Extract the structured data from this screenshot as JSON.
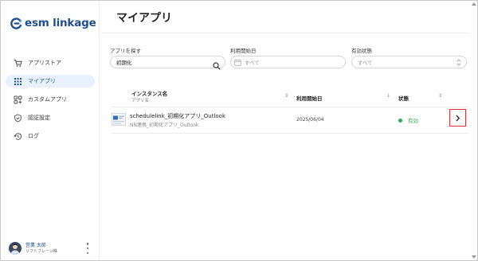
{
  "brand": {
    "logo_text": "esm linkage",
    "color": "#1f4e8c"
  },
  "sidebar": {
    "items": [
      {
        "label": "アプリストア",
        "icon": "store-icon",
        "active": false
      },
      {
        "label": "マイアプリ",
        "icon": "grid-icon",
        "active": true
      },
      {
        "label": "カスタムアプリ",
        "icon": "custom-app-icon",
        "active": false
      },
      {
        "label": "認証設定",
        "icon": "shield-icon",
        "active": false
      },
      {
        "label": "ログ",
        "icon": "history-icon",
        "active": false
      }
    ],
    "user": {
      "name": "営業 太郎",
      "org": "ソフトブレーン株"
    }
  },
  "page": {
    "title": "マイアプリ"
  },
  "filters": {
    "search": {
      "label": "アプリを探す",
      "value": "初期化",
      "icon": "search-icon"
    },
    "start_date": {
      "label": "利用開始日",
      "placeholder": "すべて",
      "icon": "calendar-icon"
    },
    "status": {
      "label": "有効状態",
      "placeholder": "すべて",
      "icon": "up-down-icon"
    }
  },
  "table": {
    "columns": {
      "instance": "インスタンス名",
      "instance_sub": "アプリ名",
      "start_date": "利用開始日",
      "status": "状態"
    },
    "rows": [
      {
        "instance_name": "schedulelink_初期化アプリ_Outlook",
        "app_name": "NN連携_初期化アプリ_Outlook",
        "start_date": "2025/06/04",
        "status": "有効",
        "status_color": "#2eaa57"
      }
    ]
  }
}
